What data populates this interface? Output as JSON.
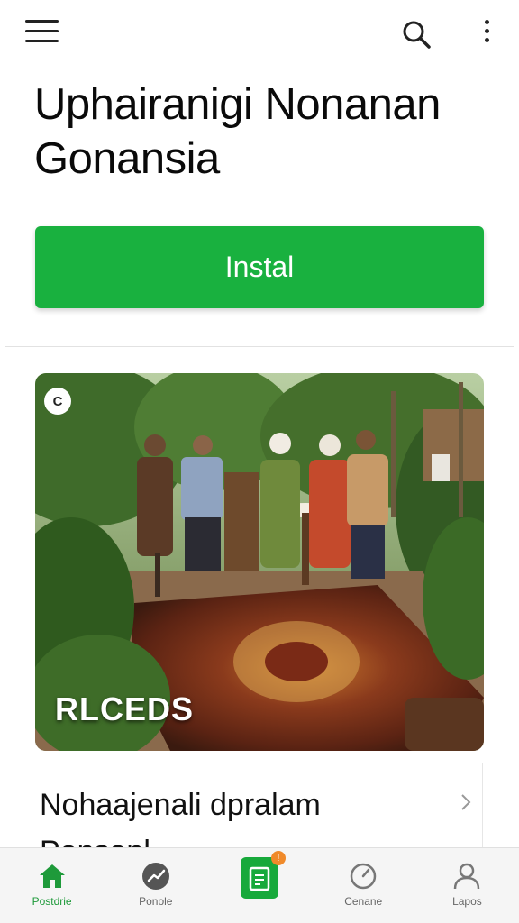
{
  "header": {
    "menu_icon": "hamburger-menu-icon",
    "search_icon": "search-icon",
    "more_icon": "more-vertical-icon"
  },
  "app": {
    "title": "Uphairanigi Nonanan Gonansia"
  },
  "install_button": {
    "label": "Instal",
    "color": "#19b13f"
  },
  "hero": {
    "badge": "C",
    "caption": "RLCEDS"
  },
  "list": {
    "title": "Nohaajenali dpralam",
    "subtitle": "Ponsanl",
    "chevron_icon": "chevron-right-icon"
  },
  "bottom_nav": {
    "items": [
      {
        "label": "Postdrie",
        "icon": "home-icon",
        "active": true
      },
      {
        "label": "Ponole",
        "icon": "trending-icon",
        "active": false
      },
      {
        "label": "",
        "icon": "clipboard-icon",
        "active": false,
        "badge": "!"
      },
      {
        "label": "Cenane",
        "icon": "gauge-icon",
        "active": false
      },
      {
        "label": "Lapos",
        "icon": "profile-icon",
        "active": false
      }
    ],
    "accent": "#1e9a3a"
  }
}
